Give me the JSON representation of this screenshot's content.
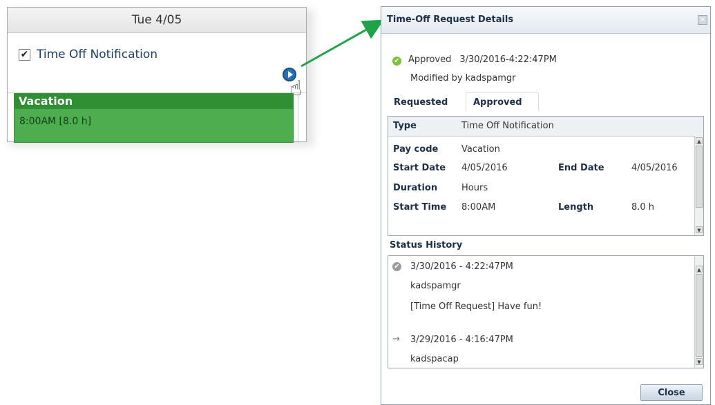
{
  "calendar": {
    "day_header": "Tue 4/05",
    "notification_label": "Time Off Notification",
    "vacation_title": "Vacation",
    "vacation_time": "8:00AM [8.0 h]"
  },
  "dialog": {
    "title": "Time-Off Request Details",
    "status": "Approved",
    "status_time": "3/30/2016-4:22:47PM",
    "modified_by": "Modified by kadspamgr",
    "tabs": [
      "Requested",
      "Approved"
    ],
    "details": {
      "type_label": "Type",
      "type_value": "Time Off Notification",
      "paycode_label": "Pay code",
      "paycode_value": "Vacation",
      "start_date_label": "Start Date",
      "start_date_value": "4/05/2016",
      "end_date_label": "End Date",
      "end_date_value": "4/05/2016",
      "duration_label": "Duration",
      "duration_value": "Hours",
      "start_time_label": "Start Time",
      "start_time_value": "8:00AM",
      "length_label": "Length",
      "length_value": "8.0 h"
    },
    "status_history_title": "Status History",
    "history": [
      {
        "time": "3/30/2016 - 4:22:47PM",
        "user": "kadspamgr",
        "note": "[Time Off Request] Have fun!"
      },
      {
        "time": "3/29/2016 - 4:16:47PM",
        "user": "kadspacap"
      }
    ],
    "close_label": "Close"
  },
  "colors": {
    "vacation_green": "#4cae4f",
    "vacation_header": "#2f8f32",
    "arrow_green": "#1fa24a",
    "link_blue": "#2a6fb4"
  }
}
